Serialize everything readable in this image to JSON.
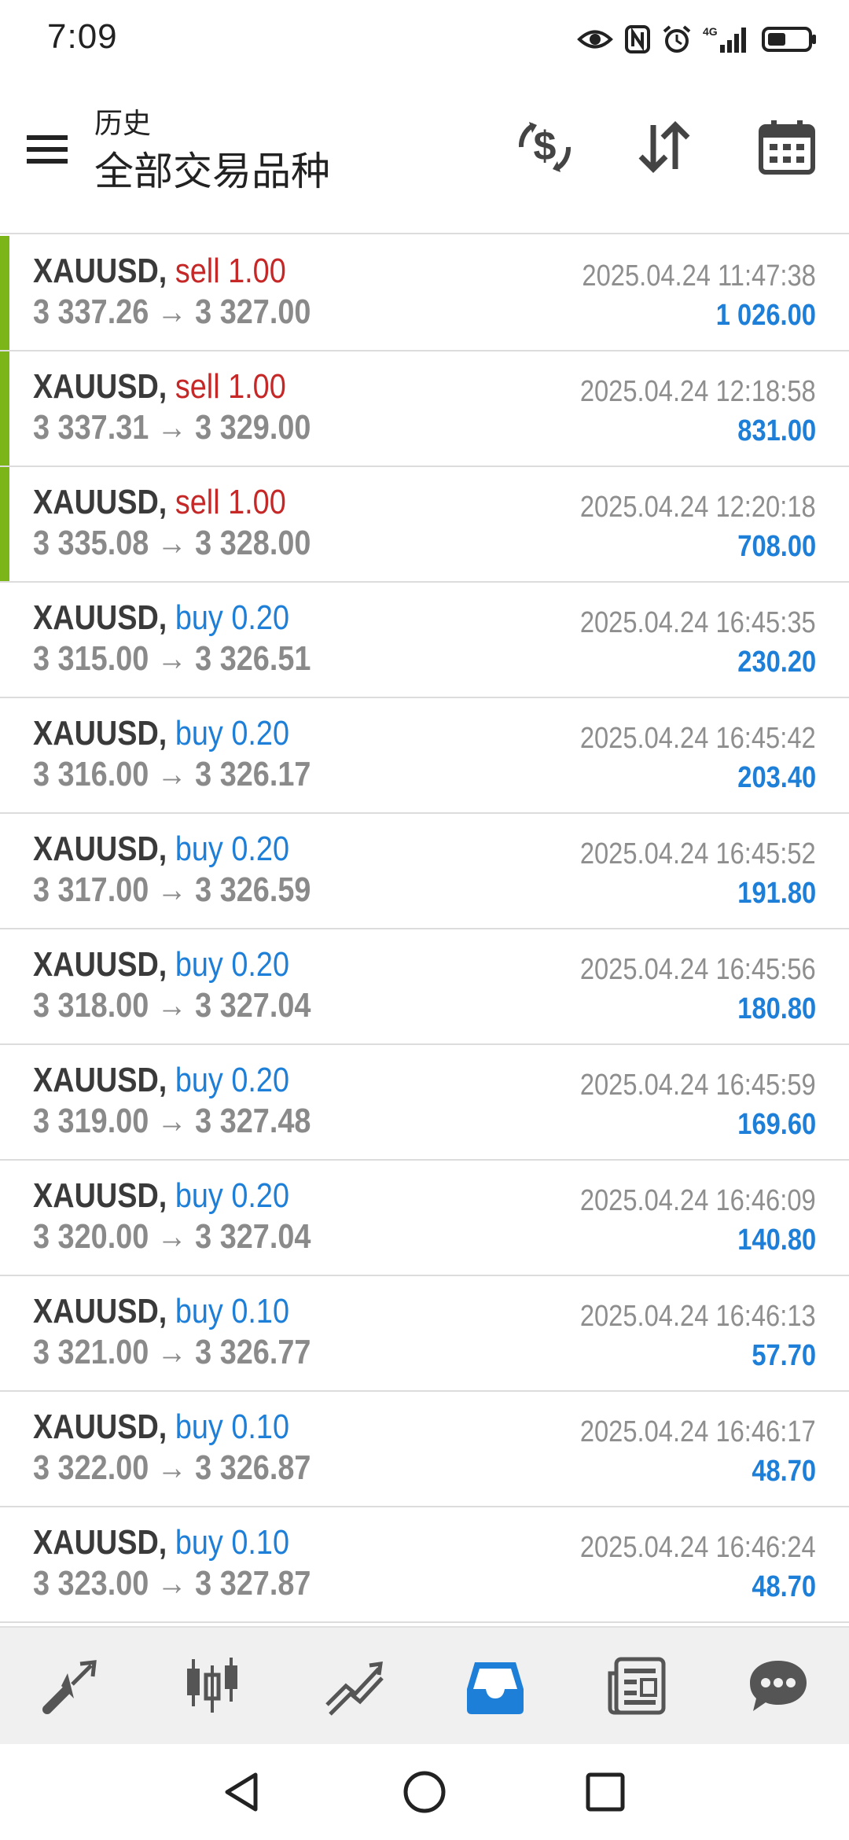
{
  "status_bar": {
    "time": "7:09",
    "network_label": "4G",
    "icons": [
      "eye-icon",
      "nfc-icon",
      "alarm-icon",
      "signal-icon",
      "battery-icon"
    ]
  },
  "header": {
    "subtitle": "历史",
    "title": "全部交易品种",
    "icons": [
      "menu-icon",
      "currency-exchange-icon",
      "sort-icon",
      "calendar-icon"
    ]
  },
  "colors": {
    "sell": "#c62828",
    "buy": "#1e7fd8",
    "profit": "#1e7fd8",
    "marker": "#7cb518",
    "active_tab": "#1e7fd8"
  },
  "trades": [
    {
      "symbol": "XAUUSD,",
      "direction": "sell",
      "label": "sell 1.00",
      "prices": "3 337.26 → 3 327.00",
      "time": "2025.04.24 11:47:38",
      "profit": "1 026.00",
      "marker": true
    },
    {
      "symbol": "XAUUSD,",
      "direction": "sell",
      "label": "sell 1.00",
      "prices": "3 337.31 → 3 329.00",
      "time": "2025.04.24 12:18:58",
      "profit": "831.00",
      "marker": true
    },
    {
      "symbol": "XAUUSD,",
      "direction": "sell",
      "label": "sell 1.00",
      "prices": "3 335.08 → 3 328.00",
      "time": "2025.04.24 12:20:18",
      "profit": "708.00",
      "marker": true
    },
    {
      "symbol": "XAUUSD,",
      "direction": "buy",
      "label": "buy 0.20",
      "prices": "3 315.00 → 3 326.51",
      "time": "2025.04.24 16:45:35",
      "profit": "230.20",
      "marker": false
    },
    {
      "symbol": "XAUUSD,",
      "direction": "buy",
      "label": "buy 0.20",
      "prices": "3 316.00 → 3 326.17",
      "time": "2025.04.24 16:45:42",
      "profit": "203.40",
      "marker": false
    },
    {
      "symbol": "XAUUSD,",
      "direction": "buy",
      "label": "buy 0.20",
      "prices": "3 317.00 → 3 326.59",
      "time": "2025.04.24 16:45:52",
      "profit": "191.80",
      "marker": false
    },
    {
      "symbol": "XAUUSD,",
      "direction": "buy",
      "label": "buy 0.20",
      "prices": "3 318.00 → 3 327.04",
      "time": "2025.04.24 16:45:56",
      "profit": "180.80",
      "marker": false
    },
    {
      "symbol": "XAUUSD,",
      "direction": "buy",
      "label": "buy 0.20",
      "prices": "3 319.00 → 3 327.48",
      "time": "2025.04.24 16:45:59",
      "profit": "169.60",
      "marker": false
    },
    {
      "symbol": "XAUUSD,",
      "direction": "buy",
      "label": "buy 0.20",
      "prices": "3 320.00 → 3 327.04",
      "time": "2025.04.24 16:46:09",
      "profit": "140.80",
      "marker": false
    },
    {
      "symbol": "XAUUSD,",
      "direction": "buy",
      "label": "buy 0.10",
      "prices": "3 321.00 → 3 326.77",
      "time": "2025.04.24 16:46:13",
      "profit": "57.70",
      "marker": false
    },
    {
      "symbol": "XAUUSD,",
      "direction": "buy",
      "label": "buy 0.10",
      "prices": "3 322.00 → 3 326.87",
      "time": "2025.04.24 16:46:17",
      "profit": "48.70",
      "marker": false
    },
    {
      "symbol": "XAUUSD,",
      "direction": "buy",
      "label": "buy 0.10",
      "prices": "3 323.00 → 3 327.87",
      "time": "2025.04.24 16:46:24",
      "profit": "48.70",
      "marker": false
    }
  ],
  "tab_bar": {
    "tabs": [
      {
        "icon": "trade-arrows-icon",
        "active": false
      },
      {
        "icon": "candlestick-chart-icon",
        "active": false
      },
      {
        "icon": "trend-lines-icon",
        "active": false
      },
      {
        "icon": "inbox-history-icon",
        "active": true
      },
      {
        "icon": "news-icon",
        "active": false
      },
      {
        "icon": "chat-bubble-icon",
        "active": false
      }
    ]
  },
  "nav_bar": {
    "icons": [
      "back-icon",
      "home-icon",
      "recents-icon"
    ]
  }
}
